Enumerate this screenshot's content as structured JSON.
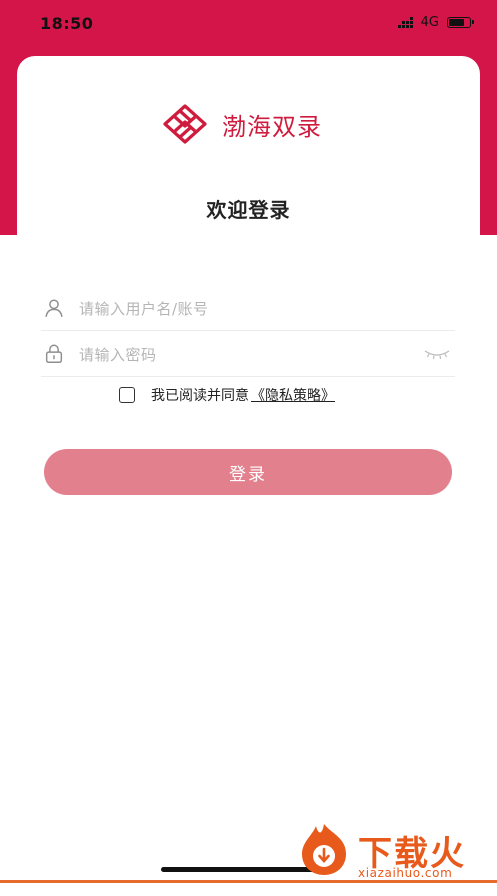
{
  "status_bar": {
    "time": "18:50",
    "network": "4G",
    "battery_level": 0.85
  },
  "brand": {
    "name": "渤海双录",
    "color": "#cf1b3d"
  },
  "welcome_title": "欢迎登录",
  "form": {
    "username_placeholder": "请输入用户名/账号",
    "password_placeholder": "请输入密码",
    "agree_text": "我已阅读并同意",
    "policy_link": "《隐私策略》",
    "login_label": "登录"
  },
  "watermark": {
    "title": "下载火",
    "url": "xiazaihuo.com"
  },
  "colors": {
    "header": "#d3154a",
    "button": "#e3808d",
    "watermark": "#e85a1c"
  },
  "icons": [
    "user-icon",
    "lock-icon",
    "eye-closed-icon",
    "checkbox-icon",
    "brand-logo-icon",
    "watermark-logo-icon"
  ]
}
